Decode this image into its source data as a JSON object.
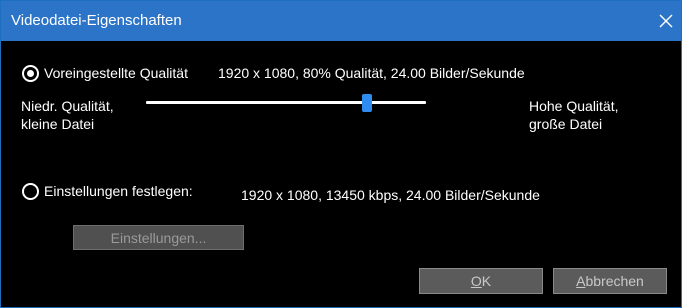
{
  "window": {
    "title": "Videodatei-Eigenschaften",
    "close_icon": "close-icon"
  },
  "preset": {
    "label": "Voreingestellte Qualität",
    "summary": "1920 x 1080, 80% Qualität, 24.00 Bilder/Sekunde",
    "selected": true
  },
  "quality_slider": {
    "low_label_line1": "Niedr. Qualität,",
    "low_label_line2": "kleine Datei",
    "high_label_line1": "Hohe Qualität,",
    "high_label_line2": "große Datei",
    "value_fraction": 0.79
  },
  "custom": {
    "label": "Einstellungen festlegen:",
    "summary": "1920 x 1080, 13450 kbps, 24.00 Bilder/Sekunde",
    "selected": false,
    "settings_button": "Einstellungen..."
  },
  "buttons": {
    "ok_underlined": "O",
    "ok_rest": "K",
    "cancel_underlined": "A",
    "cancel_rest": "bbrechen"
  },
  "colors": {
    "titlebar": "#2b74c8",
    "slider_thumb": "#2f8cf0"
  }
}
